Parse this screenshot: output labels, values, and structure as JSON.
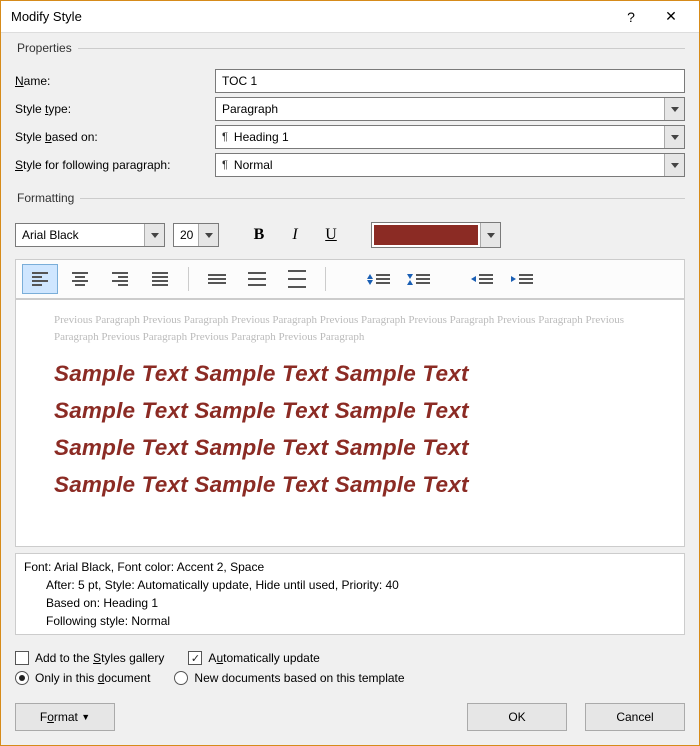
{
  "window": {
    "title": "Modify Style"
  },
  "properties": {
    "legend": "Properties",
    "name_label": "Name:",
    "name_value": "TOC 1",
    "styletype_label": "Style type:",
    "styletype_value": "Paragraph",
    "basedon_label": "Style based on:",
    "basedon_value": "Heading 1",
    "following_label": "Style for following paragraph:",
    "following_value": "Normal"
  },
  "formatting": {
    "legend": "Formatting",
    "font_name": "Arial Black",
    "font_size": "20",
    "font_color": "#8b2b24",
    "bold_label": "B",
    "italic_label": "I",
    "underline_label": "U"
  },
  "preview": {
    "context_text": "Previous Paragraph Previous Paragraph Previous Paragraph Previous Paragraph Previous Paragraph Previous Paragraph Previous Paragraph Previous Paragraph Previous Paragraph Previous Paragraph",
    "sample_line": "Sample Text Sample Text Sample Text"
  },
  "description": {
    "line1": "Font: Arial Black, Font color: Accent 2, Space",
    "line2": "After:  5 pt, Style: Automatically update, Hide until used, Priority: 40",
    "line3": "Based on: Heading 1",
    "line4": "Following style: Normal"
  },
  "options": {
    "add_gallery": "Add to the Styles gallery",
    "auto_update": "Automatically update",
    "auto_update_checked": true,
    "only_doc": "Only in this document",
    "only_doc_selected": true,
    "new_docs": "New documents based on this template"
  },
  "buttons": {
    "format": "Format",
    "ok": "OK",
    "cancel": "Cancel"
  }
}
